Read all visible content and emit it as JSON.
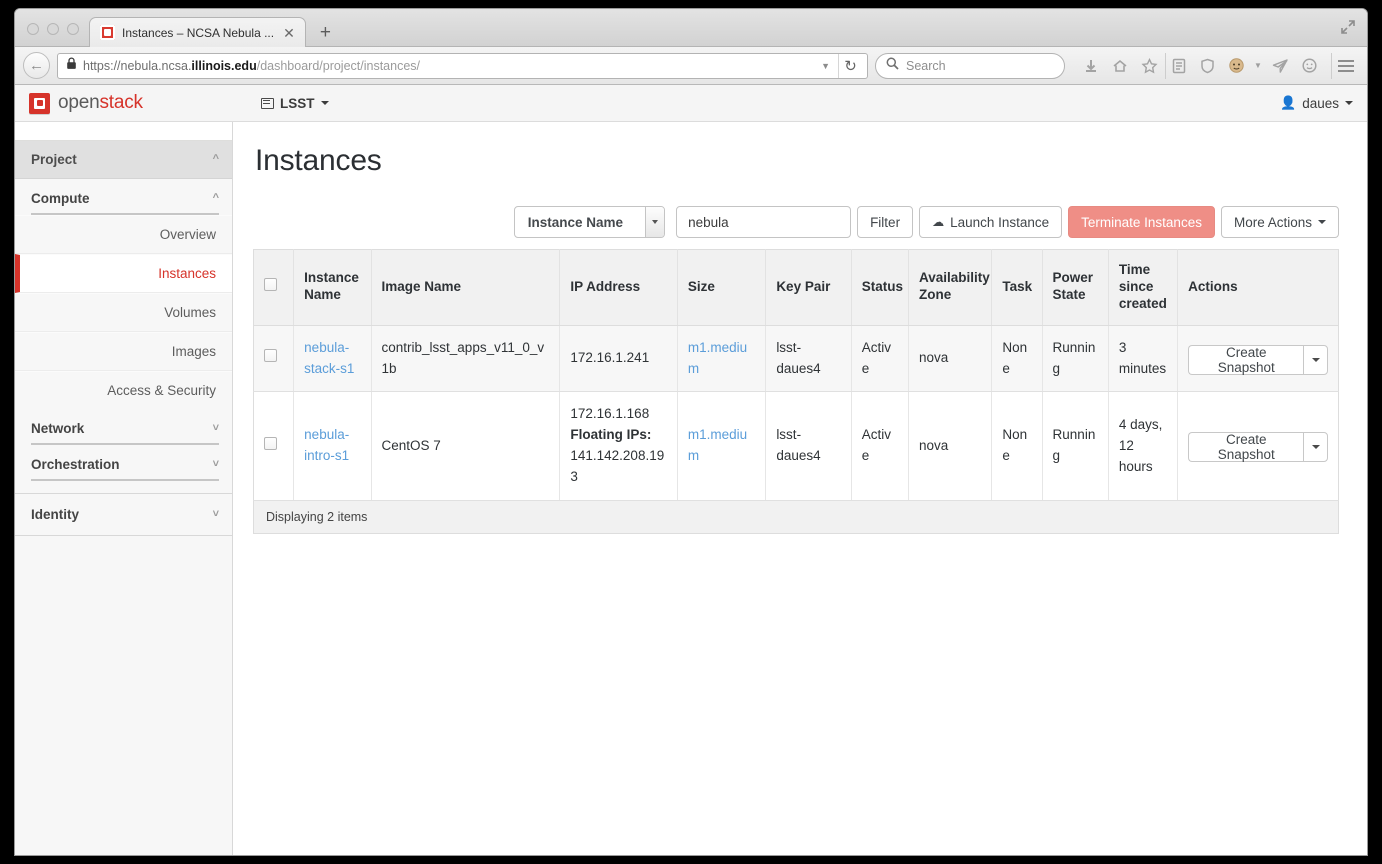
{
  "browser": {
    "tab": {
      "title": "Instances – NCSA Nebula ...",
      "close": "✕",
      "favicon": "openstack-favicon"
    },
    "newtab_label": "+",
    "url": {
      "scheme": "https://",
      "host_pre": "nebula.ncsa.",
      "host_strong": "illinois.edu",
      "path": "/dashboard/project/instances/"
    },
    "search_placeholder": "Search",
    "icons": [
      "download-icon",
      "home-icon",
      "bookmark-star-icon",
      "reader-list-icon",
      "shield-icon",
      "account-icon",
      "pocket-send-icon",
      "chat-icon",
      "hamburger-menu-icon"
    ]
  },
  "header": {
    "logo_text_1": "open",
    "logo_text_2": "stack",
    "tenant": "LSST",
    "user": "daues"
  },
  "sidebar": {
    "project_label": "Project",
    "groups": [
      {
        "label": "Compute",
        "items": [
          "Overview",
          "Instances",
          "Volumes",
          "Images",
          "Access & Security"
        ]
      },
      {
        "label": "Network",
        "items": []
      },
      {
        "label": "Orchestration",
        "items": []
      }
    ],
    "identity_label": "Identity",
    "active_item": "Instances"
  },
  "main": {
    "title": "Instances",
    "toolbar": {
      "filter_field": "Instance Name",
      "filter_value": "nebula",
      "filter_placeholder": "",
      "filter_button": "Filter",
      "launch_button": "Launch Instance",
      "terminate_button": "Terminate Instances",
      "more_actions_button": "More Actions"
    },
    "table": {
      "columns": [
        "Instance Name",
        "Image Name",
        "IP Address",
        "Size",
        "Key Pair",
        "Status",
        "Availability Zone",
        "Task",
        "Power State",
        "Time since created",
        "Actions"
      ],
      "rows": [
        {
          "name": "nebula-stack-s1",
          "image": "contrib_lsst_apps_v11_0_v1b",
          "ip": "172.16.1.241",
          "floating_label": "",
          "floating_ip": "",
          "size": "m1.medium",
          "keypair": "lsst-daues4",
          "status": "Active",
          "zone": "nova",
          "task": "None",
          "power": "Running",
          "age": "3 minutes",
          "action": "Create Snapshot"
        },
        {
          "name": "nebula-intro-s1",
          "image": "CentOS 7",
          "ip": "172.16.1.168",
          "floating_label": "Floating IPs:",
          "floating_ip": "141.142.208.193",
          "size": "m1.medium",
          "keypair": "lsst-daues4",
          "status": "Active",
          "zone": "nova",
          "task": "None",
          "power": "Running",
          "age": "4 days, 12 hours",
          "action": "Create Snapshot"
        }
      ],
      "footer": "Displaying 2 items"
    }
  },
  "colors": {
    "accent_red": "#d6332a",
    "link_blue": "#5b9dd9",
    "danger_bg": "#ef8e86"
  }
}
